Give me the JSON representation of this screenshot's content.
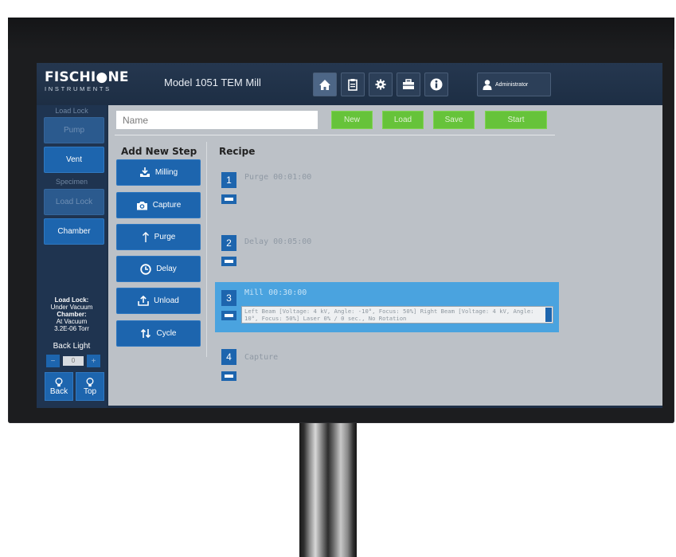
{
  "header": {
    "logo_main": "FISCHI●NE",
    "logo_sub": "INSTRUMENTS",
    "model_title": "Model 1051 TEM Mill",
    "nav_icons": [
      "home-icon",
      "clipboard-icon",
      "gear-icon",
      "toolbox-icon",
      "info-icon"
    ],
    "user_label": "Administrator"
  },
  "sidebar": {
    "loadlock_label": "Load Lock",
    "pump_label": "Pump",
    "vent_label": "Vent",
    "specimen_label": "Specimen",
    "loadlock_btn_label": "Load Lock",
    "chamber_btn_label": "Chamber",
    "status": {
      "loadlock_title": "Load Lock:",
      "loadlock_value": "Under Vacuum",
      "chamber_title": "Chamber:",
      "chamber_value": "At Vacuum",
      "pressure": "3.2E-06 Torr"
    },
    "backlight_label": "Back Light",
    "backlight_minus": "−",
    "backlight_value": "0",
    "backlight_plus": "+",
    "back_label": "Back",
    "top_label": "Top"
  },
  "toolbar": {
    "name_placeholder": "Name",
    "new_label": "New",
    "load_label": "Load",
    "save_label": "Save",
    "start_label": "Start"
  },
  "add_step": {
    "heading": "Add New Step",
    "buttons": [
      {
        "label": "Milling",
        "icon": "milling-icon"
      },
      {
        "label": "Capture",
        "icon": "camera-icon"
      },
      {
        "label": "Purge",
        "icon": "arrow-up-icon"
      },
      {
        "label": "Delay",
        "icon": "clock-icon"
      },
      {
        "label": "Unload",
        "icon": "upload-icon"
      },
      {
        "label": "Cycle",
        "icon": "cycle-icon"
      }
    ]
  },
  "recipe": {
    "heading": "Recipe",
    "steps": [
      {
        "number": "1",
        "title": "Purge 00:01:00"
      },
      {
        "number": "2",
        "title": "Delay 00:05:00"
      },
      {
        "number": "3",
        "title": "Mill 00:30:00",
        "selected": true,
        "description": "Left Beam [Voltage: 4 kV, Angle: -10°, Focus: 50%] Right Beam [Voltage: 4 kV, Angle: 10°, Focus: 50%] Laser 0% / 0 sec., No Rotation"
      },
      {
        "number": "4",
        "title": "Capture"
      }
    ]
  },
  "colors": {
    "accent_blue": "#1d65ae",
    "green_button": "#66c33a",
    "selected_step": "#4aa3df",
    "panel_gray": "#bcc1c7"
  }
}
